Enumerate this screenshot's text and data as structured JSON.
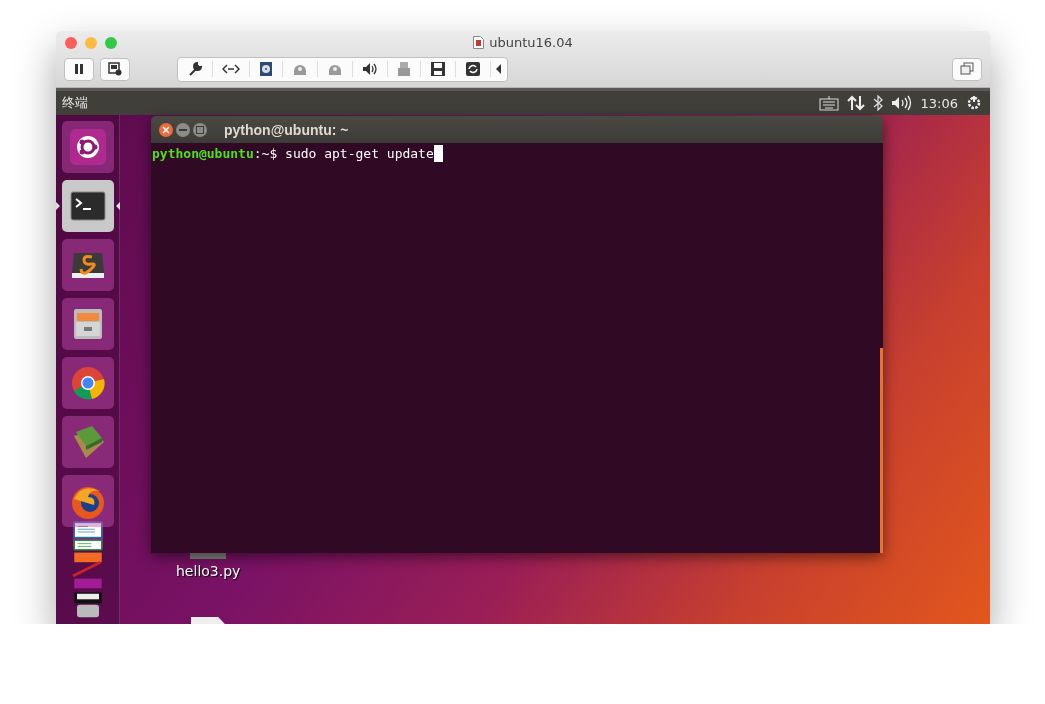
{
  "window": {
    "title": "ubuntu16.04"
  },
  "panel": {
    "app_name": "终端",
    "time": "13:06"
  },
  "launcher": {
    "items": [
      {
        "kind": "ubuntu",
        "selected": false
      },
      {
        "kind": "terminal",
        "selected": true
      },
      {
        "kind": "editor",
        "selected": false
      },
      {
        "kind": "files",
        "selected": false
      },
      {
        "kind": "browser",
        "selected": false
      },
      {
        "kind": "books",
        "selected": false
      },
      {
        "kind": "firefox",
        "selected": false
      }
    ]
  },
  "terminal": {
    "title": "python@ubuntu: ~",
    "prompt": "python@ubuntu",
    "command": ":~$ sudo apt-get update"
  },
  "desktop_icons": [
    {
      "label": "hello3.py"
    }
  ]
}
